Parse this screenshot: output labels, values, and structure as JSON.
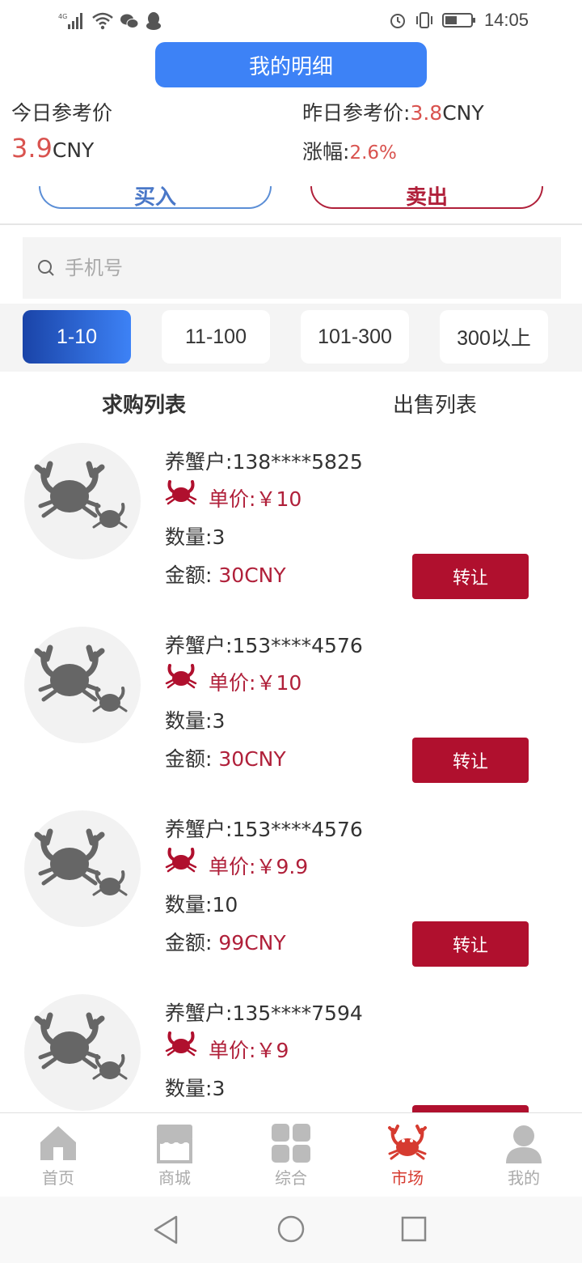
{
  "status_bar": {
    "time": "14:05",
    "network": "4G"
  },
  "header": {
    "detail_button": "我的明细"
  },
  "prices": {
    "today_label": "今日参考价",
    "today_value": "3.9",
    "today_unit": "CNY",
    "yesterday_label": "昨日参考价:",
    "yesterday_value": "3.8",
    "yesterday_unit": "CNY",
    "change_label": "涨幅:",
    "change_value": "2.6%"
  },
  "action_buttons": {
    "buy": "买入",
    "sell": "卖出"
  },
  "search": {
    "placeholder": "手机号",
    "value": ""
  },
  "range_tabs": [
    "1-10",
    "11-100",
    "101-300",
    "300以上"
  ],
  "range_selected": "1-10",
  "list_tabs": {
    "buy_list": "求购列表",
    "sell_list": "出售列表"
  },
  "labels": {
    "farmer": "养蟹户:",
    "unit_price": "单价:",
    "quantity": "数量:",
    "amount": "金额:",
    "transfer": "转让"
  },
  "rows": [
    {
      "farmer": "138****5825",
      "price": "￥10",
      "quantity": "3",
      "amount": "30CNY"
    },
    {
      "farmer": "153****4576",
      "price": "￥10",
      "quantity": "3",
      "amount": "30CNY"
    },
    {
      "farmer": "153****4576",
      "price": "￥9.9",
      "quantity": "10",
      "amount": "99CNY"
    },
    {
      "farmer": "135****7594",
      "price": "￥9",
      "quantity": "3",
      "amount": ""
    }
  ],
  "tabbar": {
    "items": [
      {
        "label": "首页",
        "icon": "home-icon"
      },
      {
        "label": "商城",
        "icon": "store-icon"
      },
      {
        "label": "综合",
        "icon": "grid-icon"
      },
      {
        "label": "市场",
        "icon": "crab-icon"
      },
      {
        "label": "我的",
        "icon": "user-icon"
      }
    ],
    "active": "市场"
  },
  "colors": {
    "primary_blue": "#3d82f6",
    "accent_red": "#b0102e",
    "price_red": "#d9534f",
    "tab_active": "#d63b30"
  }
}
